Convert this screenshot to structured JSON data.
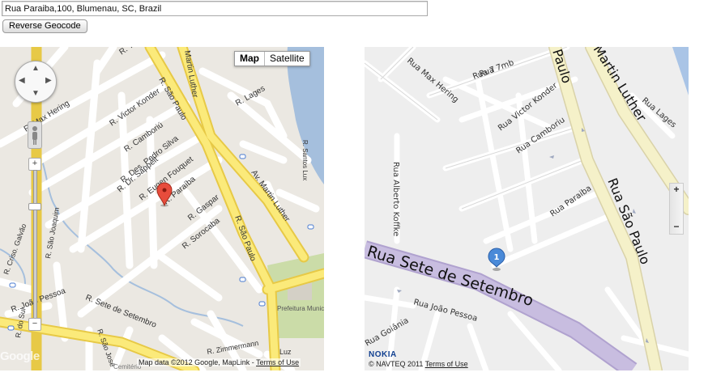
{
  "address_input": {
    "value": "Rua Paraiba,100, Blumenau, SC, Brazil"
  },
  "reverse_button": {
    "label": "Reverse Geocode"
  },
  "google_map": {
    "map_type_buttons": {
      "map": "Map",
      "satellite": "Satellite"
    },
    "zoom_in": "+",
    "zoom_out": "−",
    "logo_text": "Google",
    "data_text": "Map data ©2012 Google, MapLink -",
    "terms_link": "Terms of Use",
    "marker_icon": "red-pin-icon",
    "streets": {
      "timbo": "R. Timbó",
      "sao_paulo_1": "R. São Paulo",
      "martin_luther_top": "Martin Luther",
      "victor_konder": "R. Victor Konder",
      "lages": "R. Lages",
      "max_hering": "R. Max Hering",
      "camboriu": "R. Camboriú",
      "pedro_silva": "R. Des. Pedro Silva",
      "eugen_fouquet": "R. Eugen Fouquet",
      "sappelt": "R. Dr. Sappelt",
      "paraiba": "R. Paraíba",
      "gaspar": "R. Gaspar",
      "sorocaba": "R. Sorocaba",
      "sao_paulo_2": "R. São Paulo",
      "av_martin_luther": "Av. Martin Luther",
      "santos_lux": "R. Santos Lux",
      "galvao": "R. Criso. Galvão",
      "sao_joaquim": "R. São Joaquim",
      "joao_pessoa": "R. João Pessoa",
      "sete_setembro": "R. Sete de Setembro",
      "prefeitura": "Prefeitura Municipal",
      "do_sul": "R. do Sul",
      "sao_jose": "R. São José",
      "zimmermann": "R. Zimmermann",
      "luz": "Luz",
      "cemiterio": "Cemitério"
    }
  },
  "nokia_map": {
    "zoom_in": "+",
    "zoom_out": "−",
    "marker_label": "1",
    "brand": "NOKIA",
    "copyright": "© NAVTEQ 2011",
    "terms_link": "Terms of Use",
    "streets": {
      "rua_7": "Rua 7",
      "rua_7mb": "Rua 7mb",
      "max_hering": "Rua Max Hering",
      "victor_konder": "Rua Victor Konder",
      "camboriu": "Rua Camboriu",
      "paulo_top": "Paulo",
      "martin_luther": "Martin Luther",
      "lages": "Rua Lages",
      "alberto_koffke": "Rua Alberto Koffke",
      "paraiba": "Rua Paraiba",
      "sao_paulo": "Rua São Paulo",
      "sete_setembro": "Rua Sete de Setembro",
      "joao_pessoa": "Rua João Pessoa",
      "goiania": "Rua Goiânia"
    }
  }
}
